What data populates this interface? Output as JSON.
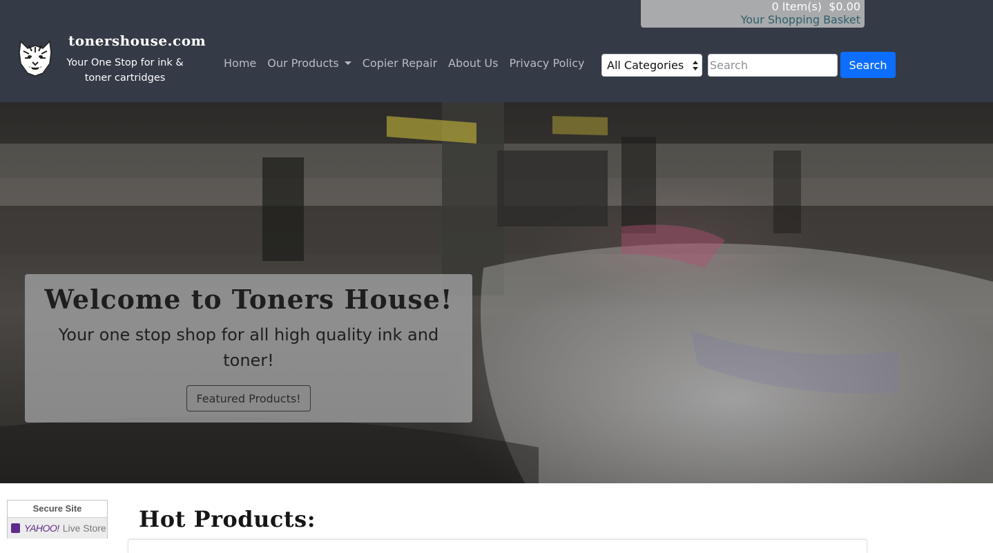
{
  "header": {
    "brand_name": "tonershouse.com",
    "tagline": "Your One Stop for ink & toner cartridges",
    "logo_icon": "tiger-logo-icon"
  },
  "basket": {
    "count_label": "0 Item(s)  $0.00",
    "label": "Your Shopping Basket"
  },
  "nav": {
    "items": [
      {
        "label": "Home"
      },
      {
        "label": "Our Products",
        "dropdown": true
      },
      {
        "label": "Copier Repair"
      },
      {
        "label": "About Us"
      },
      {
        "label": "Privacy Policy"
      }
    ]
  },
  "search": {
    "category_selected": "All Categories",
    "placeholder": "Search",
    "button_label": "Search"
  },
  "hero": {
    "title": "Welcome to Toners House!",
    "subtitle": "Your one stop shop for all high quality ink and toner!",
    "button_label": "Featured Products!"
  },
  "secure_badge": {
    "top": "Secure Site",
    "brand": "YAHOO!",
    "store": "Live Store"
  },
  "hot_products": {
    "title": "Hot Products:"
  },
  "colors": {
    "header_bg": "#343a46",
    "primary": "#0d6efd",
    "basket_bg": "#a9aaab"
  }
}
